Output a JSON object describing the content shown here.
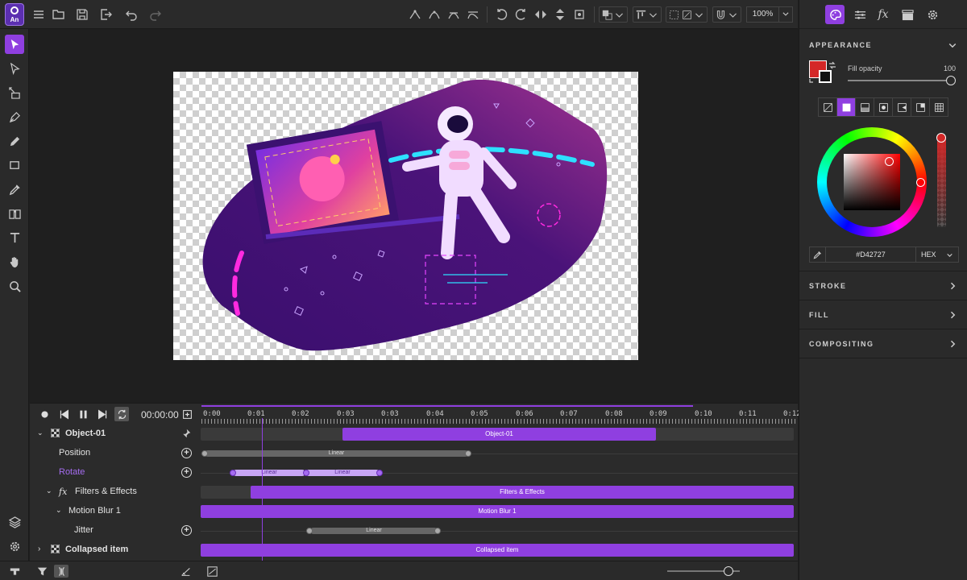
{
  "toolbar": {
    "zoom_value": "100%"
  },
  "timeline": {
    "current_time": "00:00:00",
    "ruler_labels": [
      "0:00",
      "0:01",
      "0:02",
      "0:03",
      "0:03",
      "0:04",
      "0:05",
      "0:06",
      "0:07",
      "0:08",
      "0:09",
      "0:10",
      "0:11",
      "0:12"
    ],
    "rows": {
      "object": {
        "label": "Object-01",
        "bar": "Object-01"
      },
      "position": {
        "label": "Position",
        "seg": "Linear"
      },
      "rotate": {
        "label": "Rotate",
        "seg1": "Linear",
        "seg2": "Linear"
      },
      "filters": {
        "label": "Filters & Effects",
        "bar": "Filters & Effects"
      },
      "motion": {
        "label": "Motion Blur 1",
        "bar": "Motion Blur 1"
      },
      "jitter": {
        "label": "Jitter",
        "seg": "Linear"
      },
      "collapsed": {
        "label": "Collapsed item",
        "bar": "Collapsed item"
      }
    }
  },
  "right_panel": {
    "appearance_title": "APPEARANCE",
    "fill_opacity_label": "Fill opacity",
    "fill_opacity_value": "100",
    "hex_value": "#D42727",
    "hex_format": "HEX",
    "sections": [
      "STROKE",
      "FILL",
      "COMPOSITING"
    ]
  },
  "colors": {
    "accent": "#8f3fe0",
    "selected_color": "#d42727"
  },
  "app_logo_text": "An"
}
